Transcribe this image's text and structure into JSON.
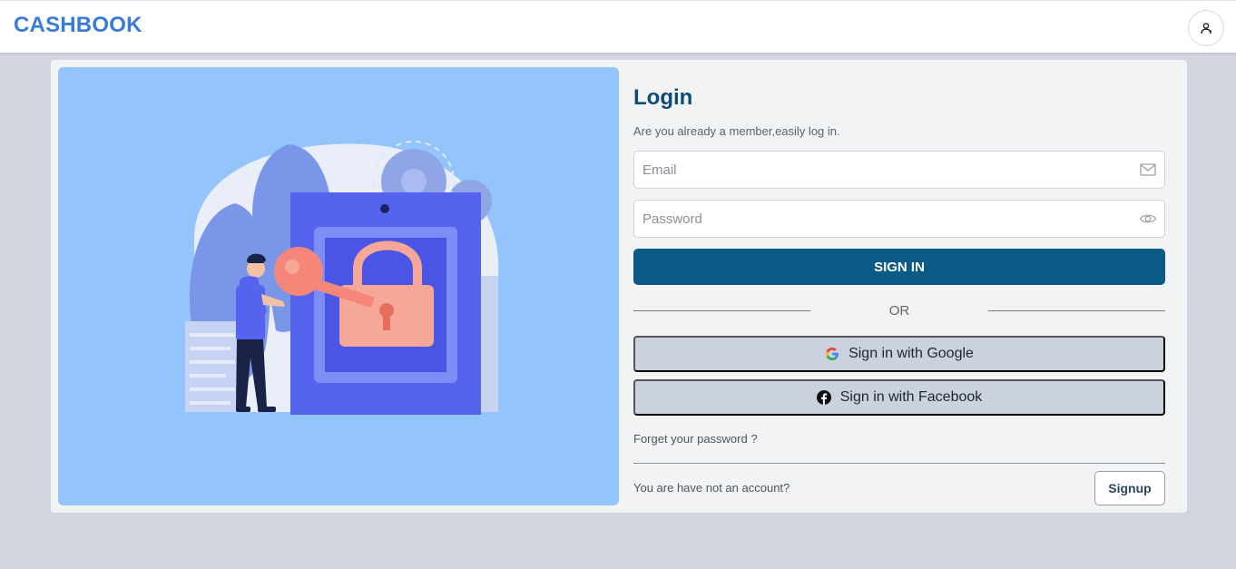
{
  "header": {
    "brand": "CASHBOOK",
    "user_icon": "user-icon"
  },
  "illustration": {
    "description_icon": "person-key-lock-illustration"
  },
  "login": {
    "title": "Login",
    "subtitle": "Are you already a member,easily log in.",
    "email": {
      "placeholder": "Email",
      "value": "",
      "icon": "mail-icon"
    },
    "password": {
      "placeholder": "Password",
      "value": "",
      "icon": "eye-icon"
    },
    "signin_label": "SIGN IN",
    "or_label": "OR",
    "google_label": "Sign in with Google",
    "facebook_label": "Sign in with Facebook",
    "forgot_label": "Forget your password ?",
    "no_account_label": "You are have not an account?",
    "signup_label": "Signup"
  },
  "colors": {
    "brand": "#3b7bd8",
    "primary": "#0b5a86",
    "title": "#0f4c75",
    "illustration_bg": "#93c4fb",
    "social_bg": "#cbd2de"
  }
}
